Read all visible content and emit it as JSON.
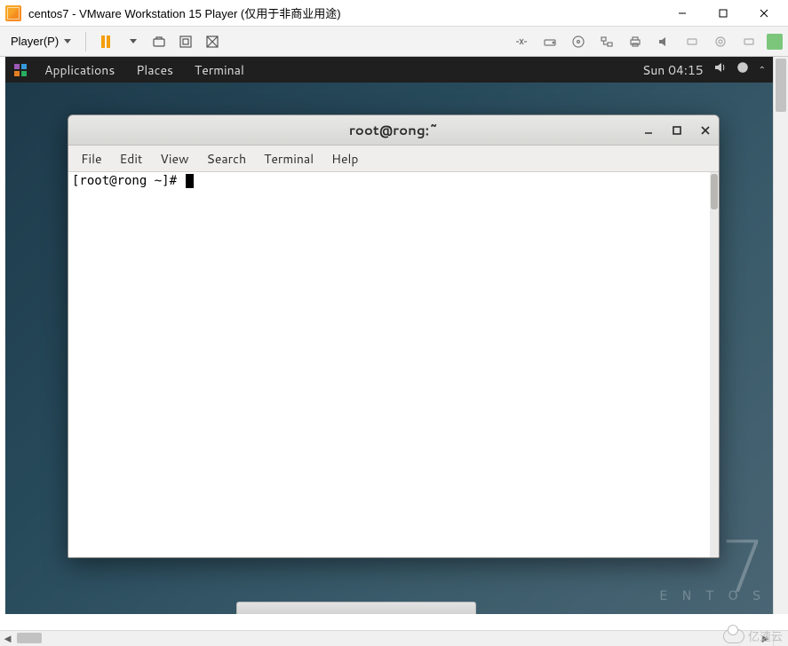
{
  "vmware": {
    "title": "centos7 - VMware Workstation 15 Player (仅用于非商业用途)",
    "player_label": "Player(P)"
  },
  "gnome": {
    "applications": "Applications",
    "places": "Places",
    "terminal": "Terminal",
    "clock": "Sun 04:15"
  },
  "terminal": {
    "title": "root@rong:~",
    "menu": {
      "file": "File",
      "edit": "Edit",
      "view": "View",
      "search": "Search",
      "terminal": "Terminal",
      "help": "Help"
    },
    "prompt": "[root@rong ~]# "
  },
  "centos_brand": {
    "number": "7",
    "label": "E N T O S"
  },
  "watermark": "亿速云"
}
